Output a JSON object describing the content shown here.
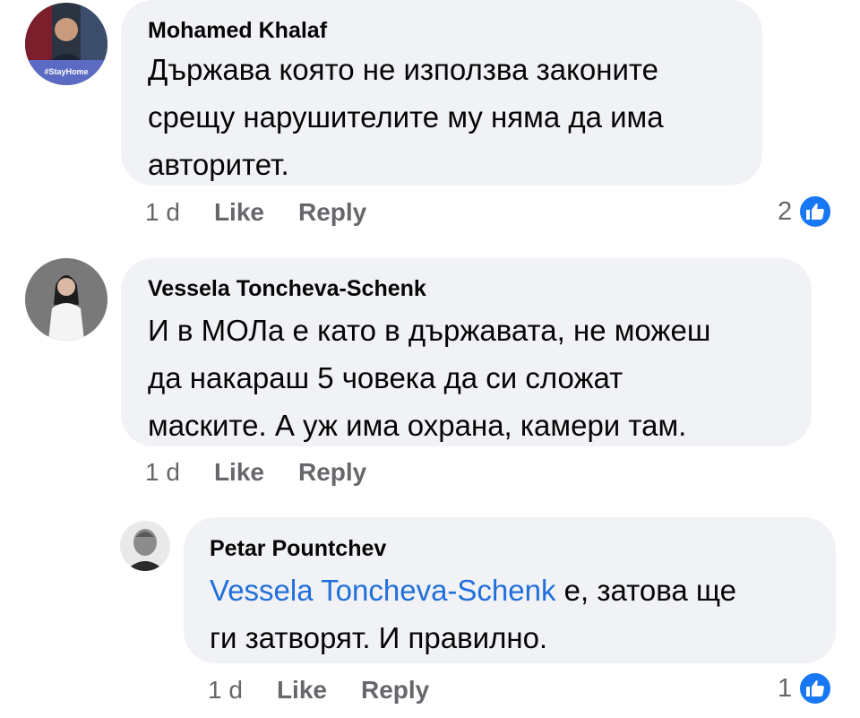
{
  "comments": [
    {
      "author": "Mohamed Khalaf",
      "avatar_caption": "#StayHome",
      "lines": [
        "Държава която не използва законите",
        "срещу нарушителите му няма да има",
        "авторитет."
      ],
      "time": "1 d",
      "like_label": "Like",
      "reply_label": "Reply",
      "reaction_count": "2",
      "reaction_icon": "like-icon"
    },
    {
      "author": "Vessela Toncheva-Schenk",
      "lines": [
        "И в МОЛа е като в държавата, не можеш",
        "да накараш 5 човека да си сложат",
        "маските. А уж има охрана, камери там."
      ],
      "time": "1 d",
      "like_label": "Like",
      "reply_label": "Reply"
    },
    {
      "author": "Petar Pountchev",
      "mention": "Vessela Toncheva-Schenk",
      "line1_rest": " е, затова ще",
      "line2": "ги затворят. И правилно.",
      "time": "1 d",
      "like_label": "Like",
      "reply_label": "Reply",
      "reaction_count": "1",
      "reaction_icon": "like-icon"
    }
  ],
  "colors": {
    "bubble": "#f0f2f5",
    "mention": "#216fdb",
    "meta": "#65676b",
    "like_badge": "#1877f2"
  }
}
